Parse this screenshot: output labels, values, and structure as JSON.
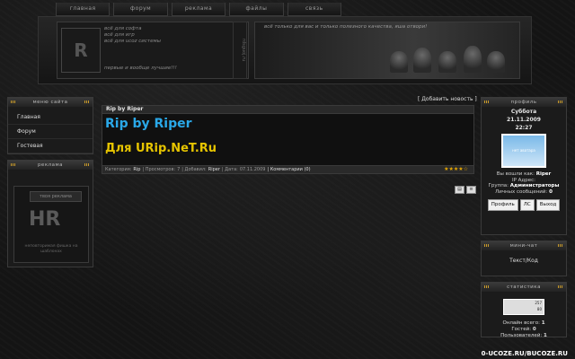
{
  "nav": [
    "главная",
    "форум",
    "реклама",
    "файлы",
    "связь"
  ],
  "header": {
    "lines": [
      "всё для софта",
      "всё для игр",
      "всё для ucoz системы"
    ],
    "tagline": "первые и вообще лучшие!!!",
    "side_text": "rdsguoj.ru",
    "slogan": "всё только для вас и только полезного качества, яша отвори!"
  },
  "left": {
    "menu_title": "меню сайта",
    "menu_items": [
      "Главная",
      "Форум",
      "Гостевая"
    ],
    "ad_title": "реклама",
    "ad_button": "твоя реклама",
    "ad_caption": "неповторимая фишка на шаблонах"
  },
  "center": {
    "add_news": "[ Добавить новость ]",
    "post_header": "Rip by Riper",
    "post_title": "Rip by Riper",
    "post_subtitle": "Для URip.NeT.Ru",
    "meta": {
      "category_label": "Категория:",
      "category": "Rip",
      "views_label": "| Просмотров:",
      "views": "7",
      "added_label": "| Добавил:",
      "author": "Riper",
      "date_label": "| Дата:",
      "date": "07.11.2009",
      "comments": "| Комментарии (0)"
    },
    "rating_stars": "★★★★☆"
  },
  "right": {
    "user_title": "профиль",
    "day": "Суббота",
    "date": "21.11.2009",
    "time": "22:27",
    "avatar_text": "нет аватара",
    "logged_as_label": "Вы вошли как:",
    "logged_as": "Riper",
    "ip_label": "IP Адрес:",
    "group_label": "Группа:",
    "group": "Администраторы",
    "messages_label": "Личных сообщений:",
    "messages": "0",
    "buttons": [
      "Профиль",
      "ЛС",
      "Выход"
    ],
    "chat_title": "мини-чат",
    "chat_text": "Текст/Код",
    "stats_title": "статистика",
    "counter_top": "257",
    "counter_bottom": "80",
    "online_total_label": "Онлайн всего:",
    "online_total": "1",
    "guests_label": "Гостей:",
    "guests": "0",
    "users_label": "Пользователей:",
    "users": "1"
  },
  "watermark": "0-UCOZE.RU/BUCOZE.RU"
}
